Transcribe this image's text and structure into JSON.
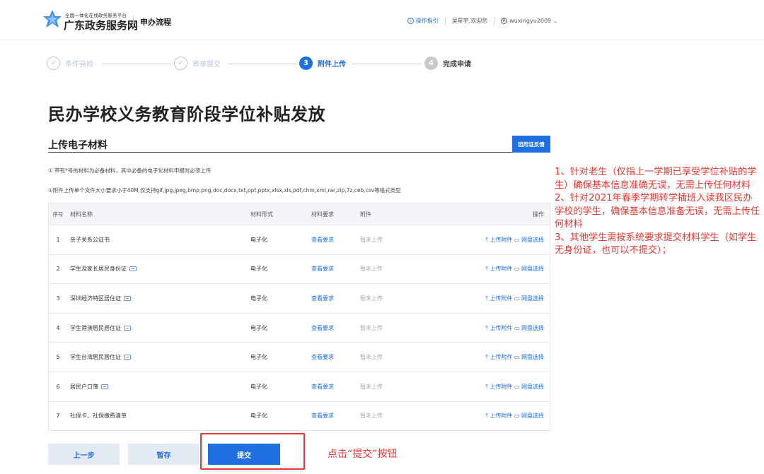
{
  "header": {
    "brand_small": "全国一体化在线政务服务平台",
    "brand_big": "广东政务服务网",
    "brand_sub": "申办流程",
    "guide": "操作指引",
    "welcome": "吴星宇,欢迎您",
    "username": "wuxingyu2009"
  },
  "steps": [
    {
      "num": "✓",
      "label": "条件自检"
    },
    {
      "num": "✓",
      "label": "表单提交"
    },
    {
      "num": "3",
      "label": "附件上传"
    },
    {
      "num": "4",
      "label": "完成申请"
    }
  ],
  "page_title": "民办学校义务教育阶段学位补贴发放",
  "section": {
    "title": "上传电子材料",
    "cert_button": "团用证反馈"
  },
  "notes": {
    "required": "① 带有*号的材料为必备材料，其中必备的电子化材料申报时必须上传",
    "size": "①附件上传单个文件大小要求小于40M,仅支持gif,jpg,jpeg,bmp,png,doc,docx,txt,ppt,pptx,xlsx,xls,pdf,chm,xml,rar,zip,7z,ceb,csv等格式类型"
  },
  "table": {
    "headers": {
      "idx": "序号",
      "name": "材料名称",
      "form": "材料形式",
      "req": "材料要求",
      "att": "附件",
      "op": "操作"
    },
    "rows": [
      {
        "idx": "1",
        "name": "亲子关系公证书",
        "form": "电子化",
        "req": "查看要求",
        "att": "暂未上传",
        "op": "⤒ 上传附件 ▭ 网盘选择"
      },
      {
        "idx": "2",
        "name": "学生及家长居民身份证",
        "form": "电子化",
        "req": "查看要求",
        "att": "暂未上传",
        "op": "⤒ 上传附件 ▭ 网盘选择"
      },
      {
        "idx": "3",
        "name": "深圳经济特区居住证",
        "form": "电子化",
        "req": "查看要求",
        "att": "暂未上传",
        "op": "⤒ 上传附件 ▭ 网盘选择"
      },
      {
        "idx": "4",
        "name": "学生港澳居民居住证",
        "form": "电子化",
        "req": "查看要求",
        "att": "暂未上传",
        "op": "⤒ 上传附件 ▭ 网盘选择"
      },
      {
        "idx": "5",
        "name": "学生台湾居民居住证",
        "form": "电子化",
        "req": "查看要求",
        "att": "暂未上传",
        "op": "⤒ 上传附件 ▭ 网盘选择"
      },
      {
        "idx": "6",
        "name": "居民户口簿",
        "form": "电子化",
        "req": "查看要求",
        "att": "暂未上传",
        "op": "⤒ 上传附件 ▭ 网盘选择"
      },
      {
        "idx": "7",
        "name": "社保卡、社保缴费清单",
        "form": "电子化",
        "req": "查看要求",
        "att": "暂未上传",
        "op": "⤒ 上传附件 ▭ 网盘选择"
      }
    ]
  },
  "buttons": {
    "prev": "上一步",
    "save": "暂存",
    "submit": "提交"
  },
  "hint": "点击“提交”按钮",
  "annotation": [
    "1、针对老生（仅指上一学期已享受学位补贴的学生）确保基本信息准确无误，无需上传任何材料",
    "2、针对2021年春季学期转学插班入读我区民办学校的学生，确保基本信息准备无误，无需上传任何材料",
    "3、其他学生需按系统要求提交材料学生（如学生无身份证，也可以不提交）；"
  ],
  "colors": {
    "accent": "#1f6fe0",
    "annotation": "#e53935"
  }
}
